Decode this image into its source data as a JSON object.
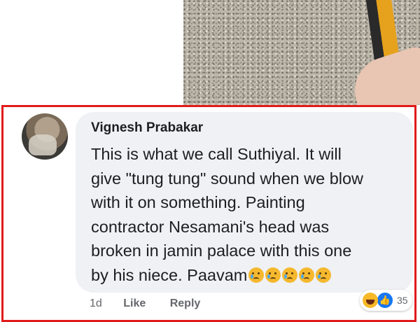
{
  "comment": {
    "author": "Vignesh Prabakar",
    "lines": [
      "This is what we call Suthiyal. It will",
      "give \"tung tung\" sound when we blow",
      "with it on something. Painting",
      "contractor Nesamani's head was",
      "broken in jamin palace with this one",
      "by his niece. Paavam"
    ],
    "trailing_emojis": [
      "crying-face",
      "crying-face",
      "crying-face",
      "crying-face",
      "crying-face"
    ],
    "actions": {
      "time": "1d",
      "like": "Like",
      "reply": "Reply"
    },
    "reactions": {
      "types": [
        "haha",
        "like"
      ],
      "count": "35"
    }
  },
  "colors": {
    "highlight_border": "#e11b1b",
    "bubble_bg": "#eff1f4",
    "text": "#1c1e21",
    "muted": "#65676b",
    "like_blue": "#1877f2"
  }
}
